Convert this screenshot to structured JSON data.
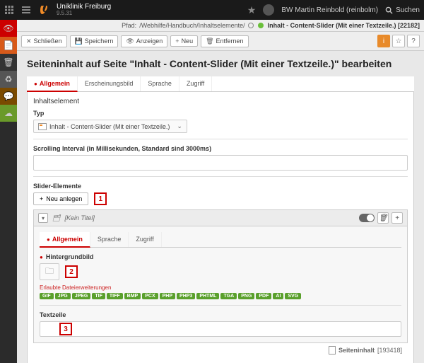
{
  "topbar": {
    "site_name": "Uniklinik Freiburg",
    "version": "9.5.31",
    "user": "BW Martin Reinbold (reinbolm)",
    "search": "Suchen"
  },
  "crumb": {
    "path_label": "Pfad:",
    "path": "/Webhilfe/Handbuch/Inhaltselemente/",
    "page": "Inhalt - Content-Slider (Mit einer Textzeile.) [22182]"
  },
  "toolbar": {
    "close": "Schließen",
    "save": "Speichern",
    "view": "Anzeigen",
    "new": "Neu",
    "remove": "Entfernen"
  },
  "heading": "Seiteninhalt auf Seite \"Inhalt - Content-Slider (Mit einer Textzeile.)\" bearbeiten",
  "tabs": {
    "general": "Allgemein",
    "appearance": "Erscheinungsbild",
    "language": "Sprache",
    "access": "Zugriff"
  },
  "panel": {
    "content_element": "Inhaltselement",
    "type_label": "Typ",
    "type_value": "Inhalt - Content-Slider (Mit einer Textzeile.)",
    "interval_label": "Scrolling Interval (in Millisekunden, Standard sind 3000ms)",
    "slider_elements": "Slider-Elemente",
    "new_item": "Neu anlegen"
  },
  "markers": {
    "m1": "1",
    "m2": "2",
    "m3": "3"
  },
  "nested": {
    "title": "[Kein Titel]",
    "tabs": {
      "general": "Allgemein",
      "language": "Sprache",
      "access": "Zugriff"
    },
    "bg_label": "Hintergrundbild",
    "allowed_label": "Erlaubte Dateierweiterungen",
    "ext": [
      "GIF",
      "JPG",
      "JPEG",
      "TIF",
      "TIFF",
      "BMP",
      "PCX",
      "PHP",
      "PHP3",
      "PHTML",
      "TGA",
      "PNG",
      "PDF",
      "AI",
      "SVG"
    ],
    "textline_label": "Textzeile"
  },
  "footer": {
    "label": "Seiteninhalt",
    "id": "[193418]"
  }
}
